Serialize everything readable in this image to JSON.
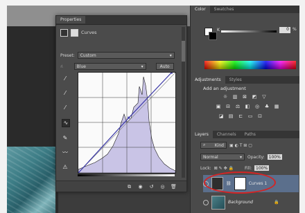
{
  "properties": {
    "tab": "Properties",
    "header": "Curves",
    "preset_label": "Preset:",
    "preset_value": "Custom",
    "channel_value": "Blue",
    "auto_button": "Auto",
    "tools": [
      "pointer-hand-icon",
      "black-eyedropper-icon",
      "gray-eyedropper-icon",
      "white-eyedropper-icon",
      "curve-wave-icon",
      "pencil-icon",
      "smooth-icon",
      "hand-warning-icon"
    ],
    "bottom_icons": [
      "clip-layer-icon",
      "eye-toggle-icon",
      "reset-icon",
      "visibility-icon",
      "trash-icon"
    ]
  },
  "curve": {
    "line_color": "#3d3aa8",
    "histogram_color": "#c9c4e6",
    "points": [
      [
        0,
        0
      ],
      [
        52,
        55
      ],
      [
        96,
        100
      ]
    ]
  },
  "color_panel": {
    "tabs": [
      "Color",
      "Swatches"
    ],
    "channel": "K",
    "value": "0",
    "unit": "%"
  },
  "adjustments": {
    "tabs": [
      "Adjustments",
      "Styles"
    ],
    "title": "Add an adjustment",
    "row1": [
      "brightness-icon",
      "levels-icon",
      "curves-icon",
      "exposure-icon",
      "triangle-icon"
    ],
    "row2": [
      "vibrance-icon",
      "hue-icon",
      "balance-icon",
      "bw-icon",
      "photo-filter-icon",
      "channel-mixer-icon",
      "grid-icon"
    ],
    "row3": [
      "invert-icon",
      "posterize-icon",
      "threshold-icon",
      "gradient-map-icon",
      "selective-color-icon"
    ]
  },
  "layers": {
    "tabs": [
      "Layers",
      "Channels",
      "Paths"
    ],
    "kind": "Kind",
    "blend_mode": "Normal",
    "opacity_label": "Opacity:",
    "opacity": "100%",
    "lock_label": "Lock:",
    "fill_label": "Fill:",
    "fill": "100%",
    "items": [
      {
        "name": "Curves 1",
        "selected": true
      },
      {
        "name": "Background",
        "selected": false
      }
    ],
    "highlight_color": "#d42424"
  }
}
